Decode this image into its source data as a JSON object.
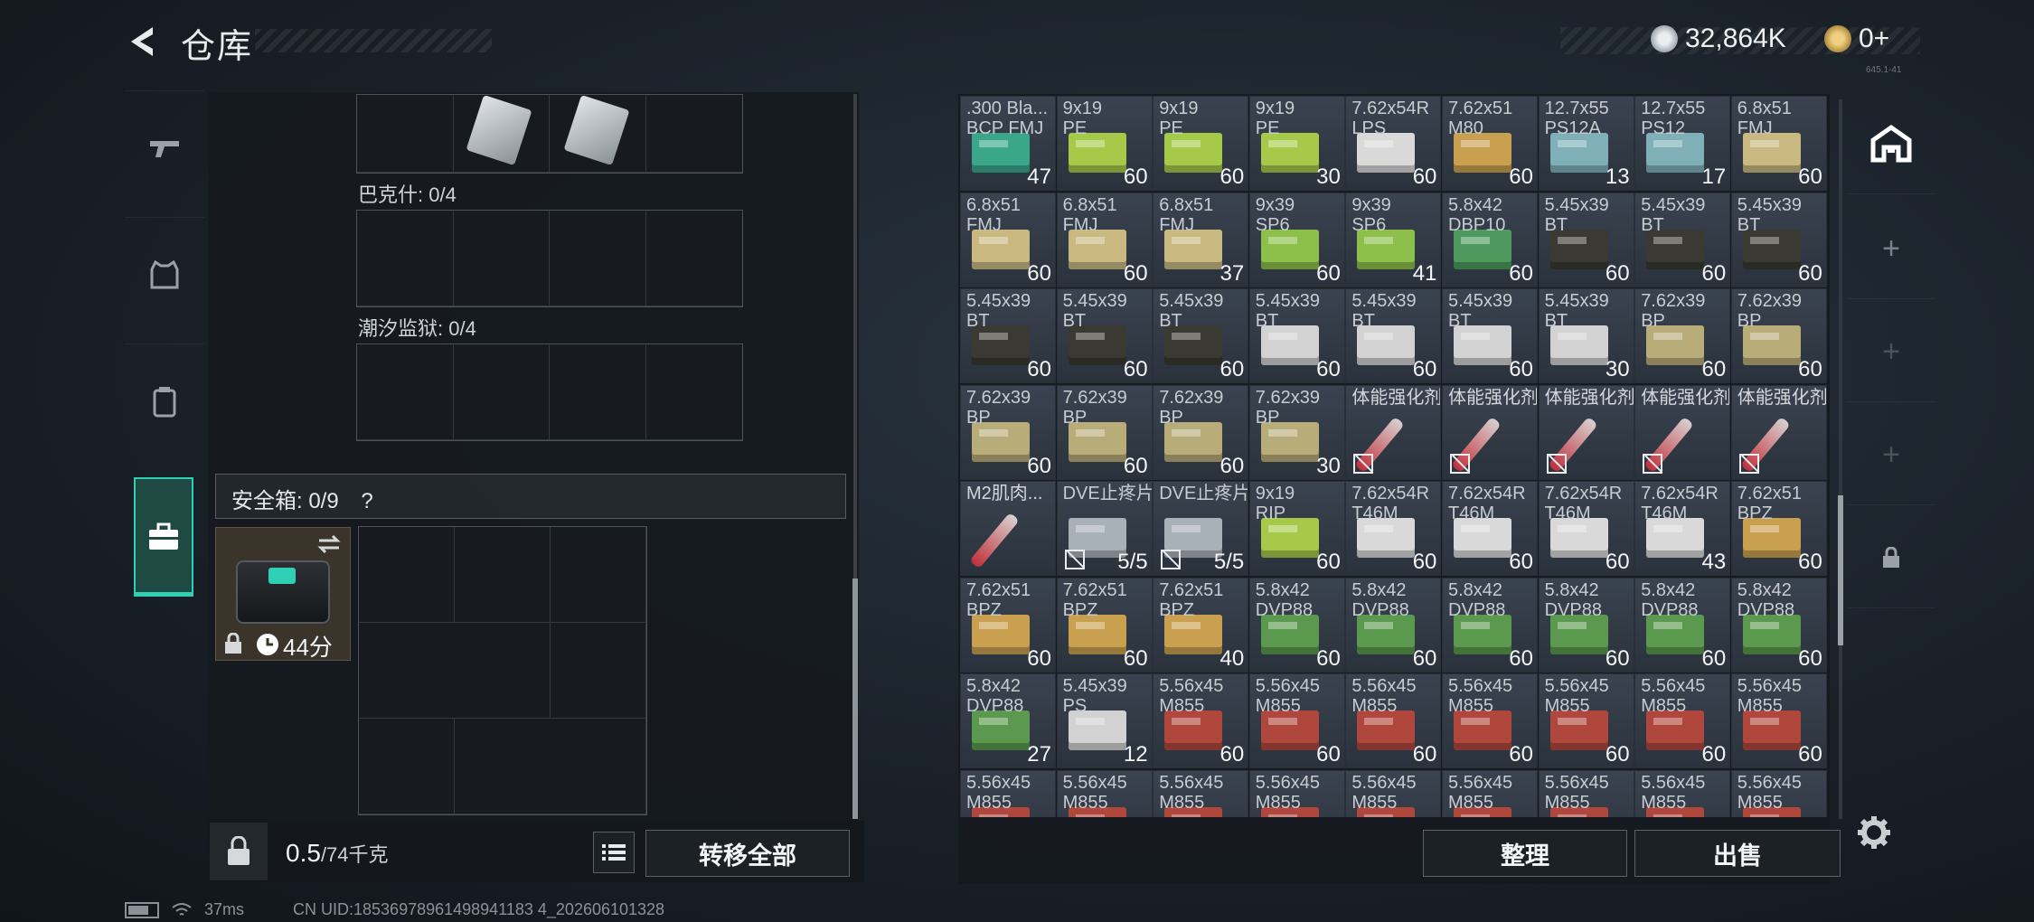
{
  "header": {
    "title": "仓库",
    "currency": "32,864K",
    "tokens": "0+",
    "mini": "645.1-41"
  },
  "left_tabs": [
    "weapon-tab",
    "armor-tab",
    "backpack-tab",
    "safebox-tab"
  ],
  "sections": {
    "bakeshi": "巴克什: 0/4",
    "chaoxi": "潮汐监狱: 0/4"
  },
  "safebox": {
    "label": "安全箱: 0/9",
    "help": "?",
    "timer": "44分"
  },
  "bottom": {
    "weight": "0.5",
    "weight_unit": "/74千克",
    "transfer_all": "转移全部",
    "organize": "整理",
    "sell": "出售"
  },
  "status": {
    "ping": "37ms",
    "uid": "CN UID:18536978961498941183 4_202606101328"
  },
  "colors": {
    "accent": "#2fd0b4"
  },
  "inventory": [
    [
      {
        "n": ".300 Bla...\nBCP FMJ",
        "q": "47",
        "c": "#3aa78a"
      },
      {
        "n": "9x19\nPE",
        "q": "60",
        "c": "#a6c94a"
      },
      {
        "n": "9x19\nPE",
        "q": "60",
        "c": "#a6c94a"
      },
      {
        "n": "9x19\nPE",
        "q": "30",
        "c": "#a6c94a"
      },
      {
        "n": "7.62x54R\nLPS",
        "q": "60",
        "c": "#d9d9d9"
      },
      {
        "n": "7.62x51\nM80",
        "q": "60",
        "c": "#c9a050"
      },
      {
        "n": "12.7x55\nPS12A",
        "q": "13",
        "c": "#7fb0b8"
      },
      {
        "n": "12.7x55\nPS12",
        "q": "17",
        "c": "#7fb0b8"
      },
      {
        "n": "6.8x51\nFMJ",
        "q": "60",
        "c": "#c9b880"
      }
    ],
    [
      {
        "n": "6.8x51\nFMJ",
        "q": "60",
        "c": "#c9b880"
      },
      {
        "n": "6.8x51\nFMJ",
        "q": "60",
        "c": "#c9b880"
      },
      {
        "n": "6.8x51\nFMJ",
        "q": "37",
        "c": "#c9b880"
      },
      {
        "n": "9x39\nSP6",
        "q": "60",
        "c": "#8cc04a"
      },
      {
        "n": "9x39\nSP6",
        "q": "41",
        "c": "#8cc04a"
      },
      {
        "n": "5.8x42\nDBP10",
        "q": "60",
        "c": "#4e9a5e"
      },
      {
        "n": "5.45x39\nBT",
        "q": "60",
        "c": "#3a3a32"
      },
      {
        "n": "5.45x39\nBT",
        "q": "60",
        "c": "#3a3a32"
      },
      {
        "n": "5.45x39\nBT",
        "q": "60",
        "c": "#3a3a32"
      }
    ],
    [
      {
        "n": "5.45x39\nBT",
        "q": "60",
        "c": "#3a3a32"
      },
      {
        "n": "5.45x39\nBT",
        "q": "60",
        "c": "#3a3a32"
      },
      {
        "n": "5.45x39\nBT",
        "q": "60",
        "c": "#3a3a32"
      },
      {
        "n": "5.45x39\nBT",
        "q": "60",
        "c": "#d2d2d2"
      },
      {
        "n": "5.45x39\nBT",
        "q": "60",
        "c": "#d2d2d2"
      },
      {
        "n": "5.45x39\nBT",
        "q": "60",
        "c": "#d2d2d2"
      },
      {
        "n": "5.45x39\nBT",
        "q": "30",
        "c": "#d2d2d2"
      },
      {
        "n": "7.62x39\nBP",
        "q": "60",
        "c": "#b8ad78"
      },
      {
        "n": "7.62x39\nBP",
        "q": "60",
        "c": "#b8ad78"
      }
    ],
    [
      {
        "n": "7.62x39\nBP",
        "q": "60",
        "c": "#b8ad78"
      },
      {
        "n": "7.62x39\nBP",
        "q": "60",
        "c": "#b8ad78"
      },
      {
        "n": "7.62x39\nBP",
        "q": "60",
        "c": "#b8ad78"
      },
      {
        "n": "7.62x39\nBP",
        "q": "30",
        "c": "#b8ad78"
      },
      {
        "n": "体能强化剂",
        "q": "",
        "c": "syringe"
      },
      {
        "n": "体能强化剂",
        "q": "",
        "c": "syringe"
      },
      {
        "n": "体能强化剂",
        "q": "",
        "c": "syringe"
      },
      {
        "n": "体能强化剂",
        "q": "",
        "c": "syringe"
      },
      {
        "n": "体能强化剂",
        "q": "",
        "c": "syringe"
      }
    ],
    [
      {
        "n": "M2肌肉...",
        "q": "",
        "c": "syringe"
      },
      {
        "n": "DVE止疼片",
        "q": "5/5",
        "c": "#a8b0b8"
      },
      {
        "n": "DVE止疼片",
        "q": "5/5",
        "c": "#a8b0b8"
      },
      {
        "n": "9x19\nRIP",
        "q": "60",
        "c": "#a6c94a"
      },
      {
        "n": "7.62x54R\nT46M",
        "q": "60",
        "c": "#d9d9d9"
      },
      {
        "n": "7.62x54R\nT46M",
        "q": "60",
        "c": "#d9d9d9"
      },
      {
        "n": "7.62x54R\nT46M",
        "q": "60",
        "c": "#d9d9d9"
      },
      {
        "n": "7.62x54R\nT46M",
        "q": "43",
        "c": "#d9d9d9"
      },
      {
        "n": "7.62x51\nBPZ",
        "q": "60",
        "c": "#c9a050"
      }
    ],
    [
      {
        "n": "7.62x51\nBPZ",
        "q": "60",
        "c": "#c9a050"
      },
      {
        "n": "7.62x51\nBPZ",
        "q": "60",
        "c": "#c9a050"
      },
      {
        "n": "7.62x51\nBPZ",
        "q": "40",
        "c": "#c9a050"
      },
      {
        "n": "5.8x42\nDVP88",
        "q": "60",
        "c": "#5b9a4e"
      },
      {
        "n": "5.8x42\nDVP88",
        "q": "60",
        "c": "#5b9a4e"
      },
      {
        "n": "5.8x42\nDVP88",
        "q": "60",
        "c": "#5b9a4e"
      },
      {
        "n": "5.8x42\nDVP88",
        "q": "60",
        "c": "#5b9a4e"
      },
      {
        "n": "5.8x42\nDVP88",
        "q": "60",
        "c": "#5b9a4e"
      },
      {
        "n": "5.8x42\nDVP88",
        "q": "60",
        "c": "#5b9a4e"
      }
    ],
    [
      {
        "n": "5.8x42\nDVP88",
        "q": "27",
        "c": "#5b9a4e"
      },
      {
        "n": "5.45x39\nPS",
        "q": "12",
        "c": "#d2d2d2"
      },
      {
        "n": "5.56x45\nM855",
        "q": "60",
        "c": "#b0473c"
      },
      {
        "n": "5.56x45\nM855",
        "q": "60",
        "c": "#b0473c"
      },
      {
        "n": "5.56x45\nM855",
        "q": "60",
        "c": "#b0473c"
      },
      {
        "n": "5.56x45\nM855",
        "q": "60",
        "c": "#b0473c"
      },
      {
        "n": "5.56x45\nM855",
        "q": "60",
        "c": "#b0473c"
      },
      {
        "n": "5.56x45\nM855",
        "q": "60",
        "c": "#b0473c"
      },
      {
        "n": "5.56x45\nM855",
        "q": "60",
        "c": "#b0473c"
      }
    ],
    [
      {
        "n": "5.56x45\nM855",
        "q": "",
        "c": "#b0473c"
      },
      {
        "n": "5.56x45\nM855",
        "q": "",
        "c": "#b0473c"
      },
      {
        "n": "5.56x45\nM855",
        "q": "",
        "c": "#b0473c"
      },
      {
        "n": "5.56x45\nM855",
        "q": "",
        "c": "#b0473c"
      },
      {
        "n": "5.56x45\nM855",
        "q": "",
        "c": "#b0473c"
      },
      {
        "n": "5.56x45\nM855",
        "q": "",
        "c": "#b0473c"
      },
      {
        "n": "5.56x45\nM855",
        "q": "",
        "c": "#b0473c"
      },
      {
        "n": "5.56x45\nM855",
        "q": "",
        "c": "#b0473c"
      },
      {
        "n": "5.56x45\nM855",
        "q": "",
        "c": "#b0473c"
      }
    ]
  ]
}
